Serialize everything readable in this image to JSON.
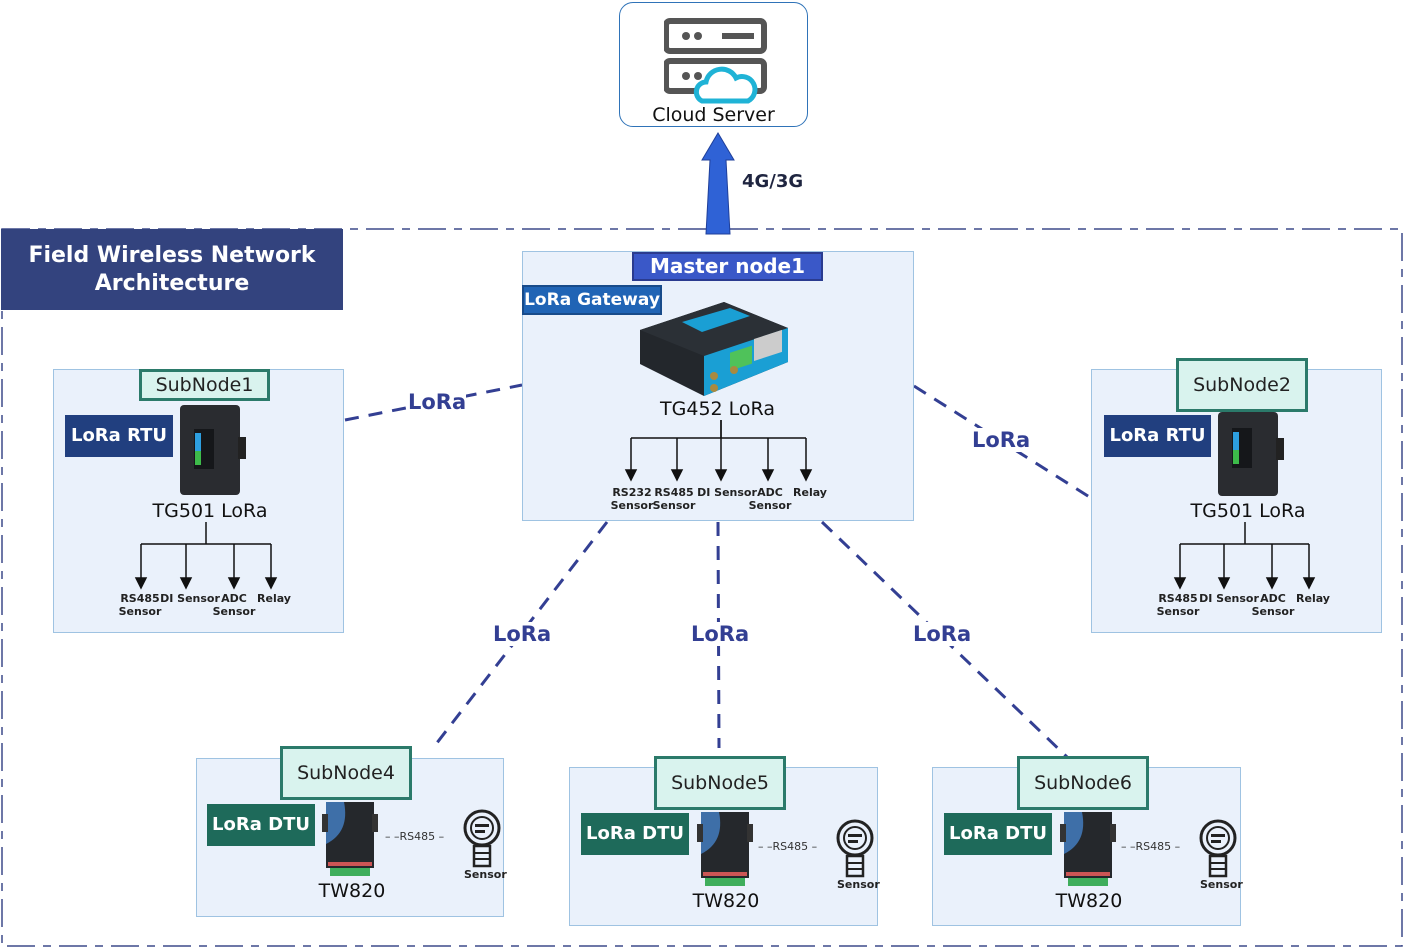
{
  "cloud": {
    "label": "Cloud Server",
    "icon": "server-cloud-icon"
  },
  "uplink": {
    "label": "4G/3G"
  },
  "field_title": {
    "line1": "Field Wireless Network",
    "line2": "Architecture"
  },
  "master": {
    "tag": "Master node1",
    "role": "LoRa Gateway",
    "model": "TG452 LoRa",
    "io": [
      {
        "line1": "RS232",
        "line2": "Sensor"
      },
      {
        "line1": "RS485",
        "line2": "Sensor"
      },
      {
        "line1": "DI Sensor",
        "line2": ""
      },
      {
        "line1": "ADC",
        "line2": "Sensor"
      },
      {
        "line1": "Relay",
        "line2": ""
      }
    ]
  },
  "subnodes": [
    {
      "tag": "SubNode1",
      "role": "LoRa RTU",
      "model": "TG501 LoRa",
      "io": [
        {
          "line1": "RS485",
          "line2": "Sensor"
        },
        {
          "line1": "DI Sensor",
          "line2": ""
        },
        {
          "line1": "ADC",
          "line2": "Sensor"
        },
        {
          "line1": "Relay",
          "line2": ""
        }
      ]
    },
    {
      "tag": "SubNode2",
      "role": "LoRa RTU",
      "model": "TG501 LoRa",
      "io": [
        {
          "line1": "RS485",
          "line2": "Sensor"
        },
        {
          "line1": "DI Sensor",
          "line2": ""
        },
        {
          "line1": "ADC",
          "line2": "Sensor"
        },
        {
          "line1": "Relay",
          "line2": ""
        }
      ]
    },
    {
      "tag": "SubNode4",
      "role": "LoRa DTU",
      "model": "TW820",
      "link": "RS485",
      "sensor": "Sensor"
    },
    {
      "tag": "SubNode5",
      "role": "LoRa DTU",
      "model": "TW820",
      "link": "RS485",
      "sensor": "Sensor"
    },
    {
      "tag": "SubNode6",
      "role": "LoRa DTU",
      "model": "TW820",
      "link": "RS485",
      "sensor": "Sensor"
    }
  ],
  "links": {
    "label": "LoRa"
  },
  "colors": {
    "link": "#333f93",
    "title_bg": "#33437e",
    "master_tag": "#3a58c8",
    "gateway_tag": "#2064b5",
    "subnode_tag_bg": "#d9f3ee",
    "subnode_tag_border": "#2b7a6a",
    "rtu_tag": "#213f7f",
    "dtu_tag": "#1e6a5a",
    "panel_bg": "#eaf1fb",
    "uplink_arrow": "#2f62d6"
  }
}
